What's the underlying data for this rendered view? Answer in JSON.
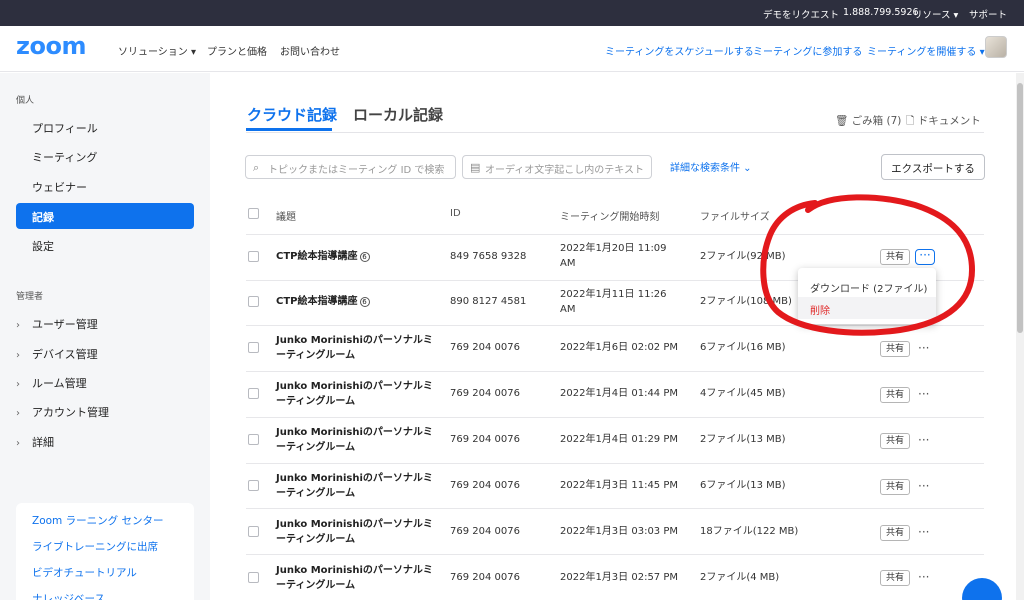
{
  "topbar": {
    "demo": "デモをリクエスト",
    "phone": "1.888.799.5926",
    "resources": "リソース ▾",
    "support": "サポート"
  },
  "header": {
    "logo": "zoom",
    "nav": [
      "ソリューション ▾",
      "プランと価格",
      "お問い合わせ"
    ],
    "right_links": [
      "ミーティングをスケジュールする",
      "ミーティングに参加する",
      "ミーティングを開催する ▾"
    ]
  },
  "sidebar": {
    "personal_label": "個人",
    "personal_items": [
      "プロフィール",
      "ミーティング",
      "ウェビナー",
      "記録",
      "設定"
    ],
    "active_item": "記録",
    "admin_label": "管理者",
    "admin_items": [
      "ユーザー管理",
      "デバイス管理",
      "ルーム管理",
      "アカウント管理",
      "詳細"
    ],
    "learning_links": [
      "Zoom ラーニング センター",
      "ライブトレーニングに出席",
      "ビデオチュートリアル",
      "ナレッジベース"
    ]
  },
  "tabs": {
    "cloud": "クラウド記録",
    "local": "ローカル記録"
  },
  "top_links": {
    "trash": "ごみ箱 (7)",
    "docs": "ドキュメント"
  },
  "filters": {
    "topic_placeholder": "トピックまたはミーティング ID で検索",
    "audio_placeholder": "オーディオ文字起こし内のテキスト",
    "advanced": "詳細な検索条件 ⌄",
    "export": "エクスポートする"
  },
  "table": {
    "headers": [
      "議題",
      "ID",
      "ミーティング開始時刻",
      "ファイルサイズ"
    ],
    "share_label": "共有",
    "more_label": "···",
    "rows": [
      {
        "topic": "CTP絵本指導講座",
        "badge": "6",
        "id": "849 7658 9328",
        "start": "2022年1月20日 11:09 AM",
        "files": "2ファイル(92 MB)"
      },
      {
        "topic": "CTP絵本指導講座",
        "badge": "6",
        "id": "890 8127 4581",
        "start": "2022年1月11日 11:26 AM",
        "files": "2ファイル(108 MB)"
      },
      {
        "topic": "Junko Morinishiのパーソナルミーティングルーム",
        "id": "769 204 0076",
        "start": "2022年1月6日 02:02 PM",
        "files": "6ファイル(16 MB)"
      },
      {
        "topic": "Junko Morinishiのパーソナルミーティングルーム",
        "id": "769 204 0076",
        "start": "2022年1月4日 01:44 PM",
        "files": "4ファイル(45 MB)"
      },
      {
        "topic": "Junko Morinishiのパーソナルミーティングルーム",
        "id": "769 204 0076",
        "start": "2022年1月4日 01:29 PM",
        "files": "2ファイル(13 MB)"
      },
      {
        "topic": "Junko Morinishiのパーソナルミーティングルーム",
        "id": "769 204 0076",
        "start": "2022年1月3日 11:45 PM",
        "files": "6ファイル(13 MB)"
      },
      {
        "topic": "Junko Morinishiのパーソナルミーティングルーム",
        "id": "769 204 0076",
        "start": "2022年1月3日 03:03 PM",
        "files": "18ファイル(122 MB)"
      },
      {
        "topic": "Junko Morinishiのパーソナルミーティングルーム",
        "id": "769 204 0076",
        "start": "2022年1月3日 02:57 PM",
        "files": "2ファイル(4 MB)"
      }
    ]
  },
  "dropdown": {
    "download": "ダウンロード (2ファイル)",
    "delete": "削除"
  },
  "colors": {
    "accent": "#0e72ed",
    "topbar": "#2d2f3e",
    "delete": "#e02828",
    "annotation": "#e3191c"
  }
}
